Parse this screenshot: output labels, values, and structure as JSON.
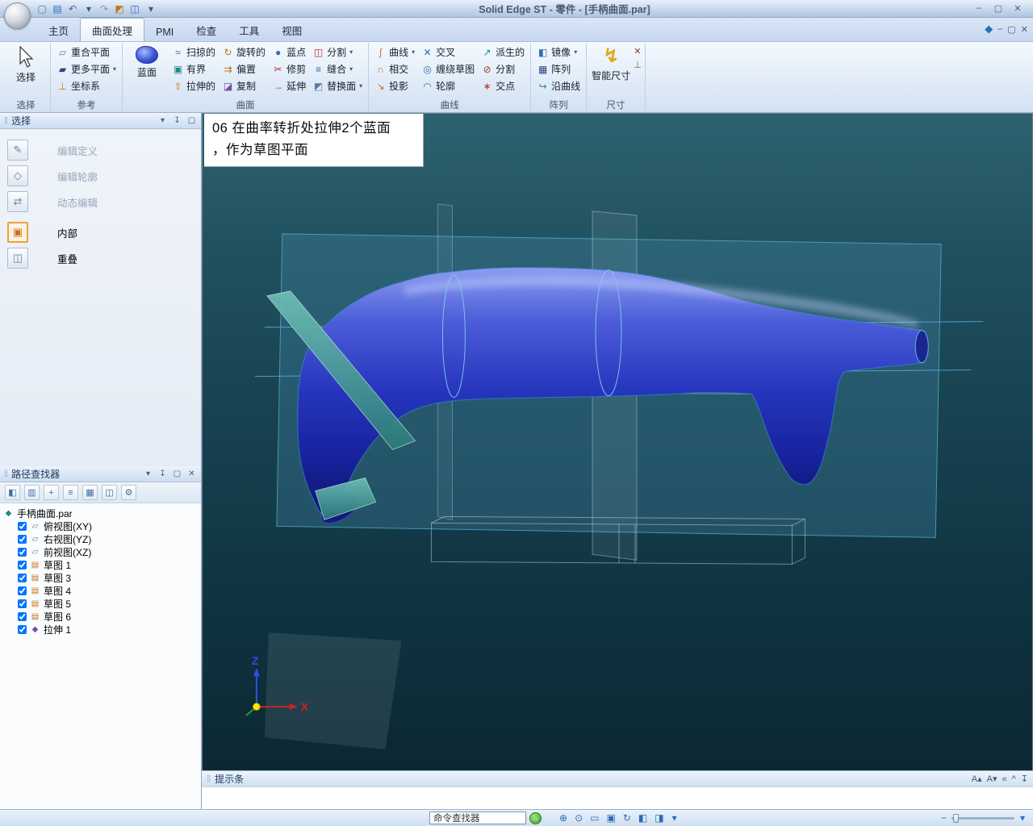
{
  "window": {
    "title": "Solid Edge ST - 零件 - [手柄曲面.par]"
  },
  "tabs": [
    {
      "label": "主页"
    },
    {
      "label": "曲面处理"
    },
    {
      "label": "PMI"
    },
    {
      "label": "检查"
    },
    {
      "label": "工具"
    },
    {
      "label": "视图"
    }
  ],
  "ribbon": {
    "select": {
      "label": "选择",
      "group_label": "选择"
    },
    "reference": {
      "group_label": "参考",
      "items": [
        {
          "label": "重合平面"
        },
        {
          "label": "更多平面"
        },
        {
          "label": "坐标系"
        }
      ]
    },
    "surface": {
      "group_label": "曲面",
      "bluesurf_label": "蓝面",
      "items": [
        {
          "label": "扫掠的"
        },
        {
          "label": "旋转的"
        },
        {
          "label": "蓝点"
        },
        {
          "label": "分割"
        },
        {
          "label": "有界"
        },
        {
          "label": "偏置"
        },
        {
          "label": "修剪"
        },
        {
          "label": "缝合"
        },
        {
          "label": "拉伸的"
        },
        {
          "label": "复制"
        },
        {
          "label": "延伸"
        },
        {
          "label": "替换面"
        }
      ]
    },
    "curve": {
      "group_label": "曲线",
      "items": [
        {
          "label": "曲线"
        },
        {
          "label": "交叉"
        },
        {
          "label": "派生的"
        },
        {
          "label": "相交"
        },
        {
          "label": "缠绕草图"
        },
        {
          "label": "分割"
        },
        {
          "label": "投影"
        },
        {
          "label": "轮廓"
        },
        {
          "label": "交点"
        }
      ]
    },
    "pattern": {
      "group_label": "阵列",
      "items": [
        {
          "label": "镜像"
        },
        {
          "label": "阵列"
        },
        {
          "label": "沿曲线"
        }
      ]
    },
    "dimension": {
      "group_label": "尺寸",
      "label": "智能尺寸"
    }
  },
  "select_panel": {
    "title": "选择",
    "tools": [
      {
        "label": "编辑定义"
      },
      {
        "label": "编辑轮廓"
      },
      {
        "label": "动态编辑"
      }
    ],
    "options": [
      {
        "label": "内部"
      },
      {
        "label": "重叠"
      }
    ]
  },
  "pathfinder": {
    "title": "路径查找器",
    "root": "手柄曲面.par",
    "items": [
      {
        "label": "俯视图(XY)",
        "checked": true
      },
      {
        "label": "右视图(YZ)",
        "checked": true
      },
      {
        "label": "前视图(XZ)",
        "checked": true
      },
      {
        "label": "草图 1",
        "checked": true
      },
      {
        "label": "草图 3",
        "checked": true
      },
      {
        "label": "草图 4",
        "checked": true
      },
      {
        "label": "草图 5",
        "checked": true
      },
      {
        "label": "草图 6",
        "checked": true
      },
      {
        "label": "拉伸 1",
        "checked": true
      }
    ]
  },
  "viewport": {
    "annotation_line1": "06 在曲率转折处拉伸2个蓝面",
    "annotation_line2": "，作为草图平面",
    "axis_x": "X",
    "axis_z": "Z"
  },
  "prompt_bar": {
    "label": "提示条"
  },
  "status_bar": {
    "command_finder": "命令查找器"
  },
  "colors": {
    "model_blue": "#2c3cc4",
    "viewport_top": "#2e6270",
    "viewport_bottom": "#0b2833",
    "teal_plane": "#3f8f8a",
    "accent_orange": "#e8a23c"
  },
  "icons": {
    "dropdown": "▾",
    "qat_new": "▢",
    "qat_save": "▤",
    "qat_undo": "↶",
    "qat_redo": "↷",
    "qat_screen1": "◩",
    "qat_screen2": "◫",
    "qat_more": "▾",
    "win_min": "–",
    "win_max": "▢",
    "win_close": "✕",
    "help": "◆",
    "grip": "⁞⁞",
    "panel_chevron": "▾",
    "panel_pin": "↧",
    "panel_max": "▢",
    "panel_close": "✕",
    "coincident_plane": "▱",
    "more_planes": "▰",
    "coordinate_system": "⊥",
    "swept": "≈",
    "revolved": "↻",
    "bluepoint": "●",
    "divide": "◫",
    "bounded": "▣",
    "offset": "⇉",
    "trim": "✂",
    "stitch": "≡",
    "extruded": "⇧",
    "copy": "◪",
    "extend": "→",
    "replace_face": "◩",
    "curve": "∫",
    "cross": "✕",
    "derived": "↗",
    "intersect": "∩",
    "wrap_sketch": "◎",
    "split_curve": "⊘",
    "projection": "↘",
    "contour": "◠",
    "intersection_point": "∗",
    "mirror": "◧",
    "pattern": "▦",
    "along_curve": "↪",
    "smart_dimension": "↯",
    "edit_definition": "✎",
    "edit_profile": "◇",
    "dynamic_edit": "⇄",
    "inside": "▣",
    "overlap": "◫",
    "pf_root": "◆",
    "plane_item": "▱",
    "sketch_item": "▤",
    "extrude_item": "◆",
    "pf1": "◧",
    "pf2": "▥",
    "pf3": "+",
    "pf4": "≡",
    "pf5": "▦",
    "pf6": "◫",
    "pf7": "⚙",
    "prompt_font_up": "A▴",
    "prompt_font_down": "A▾",
    "prompt_collapse": "«",
    "prompt_chevron": "^",
    "prompt_pin": "↧",
    "go": "→",
    "s1": "⊕",
    "s2": "⊙",
    "s3": "▭",
    "s4": "▣",
    "s5": "↻",
    "s6": "◧",
    "s7": "◨",
    "s8": "▾",
    "minus": "−"
  }
}
